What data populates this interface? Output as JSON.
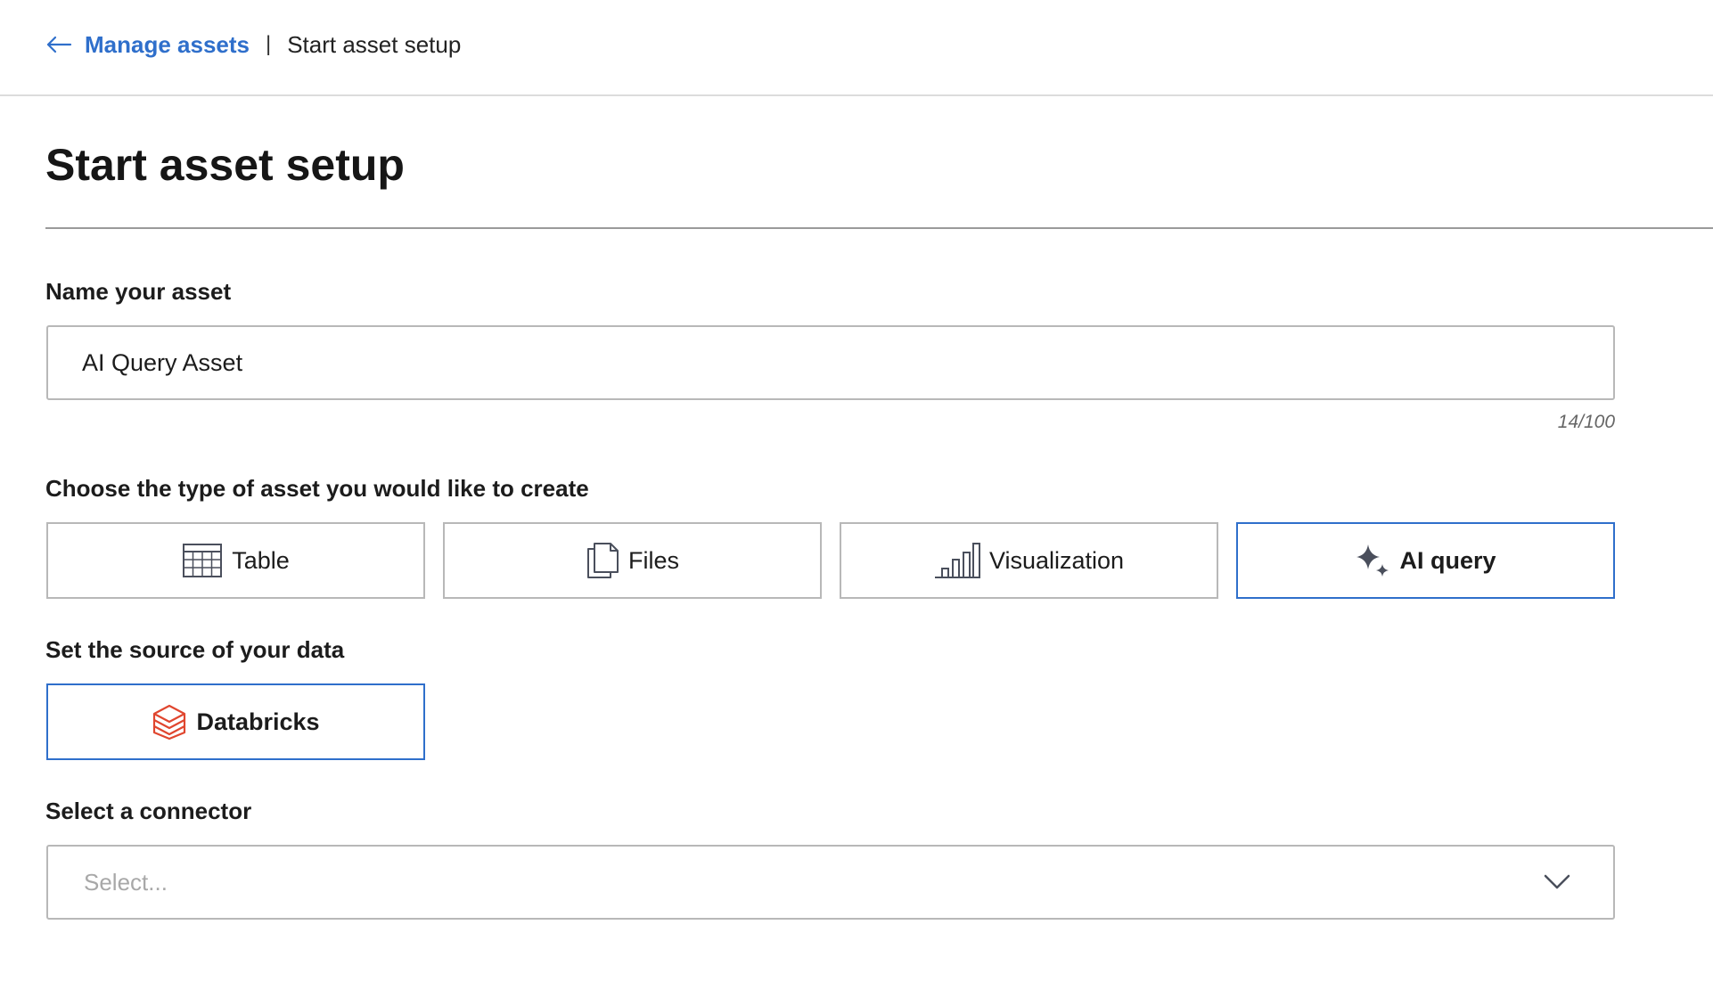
{
  "breadcrumb": {
    "back_label": "Manage assets",
    "separator": "|",
    "current": "Start asset setup"
  },
  "page": {
    "title": "Start asset setup"
  },
  "name_field": {
    "label": "Name your asset",
    "value": "AI Query Asset",
    "char_count": "14/100"
  },
  "asset_type": {
    "label": "Choose the type of asset you would like to create",
    "options": [
      {
        "label": "Table",
        "icon": "table-icon",
        "selected": false
      },
      {
        "label": "Files",
        "icon": "files-icon",
        "selected": false
      },
      {
        "label": "Visualization",
        "icon": "bar-chart-icon",
        "selected": false
      },
      {
        "label": "AI query",
        "icon": "sparkle-icon",
        "selected": true
      }
    ]
  },
  "source": {
    "label": "Set the source of your data",
    "options": [
      {
        "label": "Databricks",
        "icon": "databricks-icon",
        "selected": true
      }
    ]
  },
  "connector": {
    "label": "Select a connector",
    "placeholder": "Select..."
  },
  "colors": {
    "accent": "#2f6fcb",
    "border": "#b8b8b8",
    "databricks": "#e0462f",
    "icon": "#4a4f5c"
  }
}
